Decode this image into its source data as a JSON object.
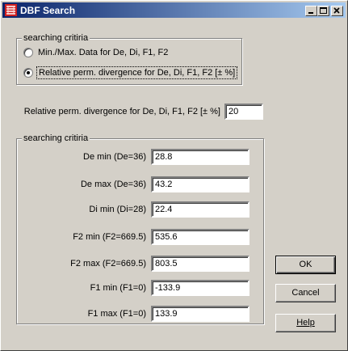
{
  "window": {
    "title": "DBF Search"
  },
  "group1": {
    "legend": "searching critiria",
    "options": [
      {
        "label": "Min./Max. Data for De, Di, F1, F2",
        "checked": false
      },
      {
        "label": "Relative perm. divergence for De, Di, F1, F2 [± %]",
        "checked": true
      }
    ]
  },
  "divergence": {
    "label": "Relative perm. divergence for De, Di, F1, F2 [± %]",
    "value": "20"
  },
  "group2": {
    "legend": "searching critiria",
    "fields": [
      {
        "label": "De min (De=36)",
        "value": "28.8"
      },
      {
        "label": "De max (De=36)",
        "value": "43.2"
      },
      {
        "label": "Di min (Di=28)",
        "value": "22.4"
      },
      {
        "label": "F2 min (F2=669.5)",
        "value": "535.6"
      },
      {
        "label": "F2 max (F2=669.5)",
        "value": "803.5"
      },
      {
        "label": "F1 min (F1=0)",
        "value": "-133.9"
      },
      {
        "label": "F1 max (F1=0)",
        "value": "133.9"
      }
    ]
  },
  "buttons": {
    "ok": "OK",
    "cancel": "Cancel",
    "help": "Help"
  }
}
